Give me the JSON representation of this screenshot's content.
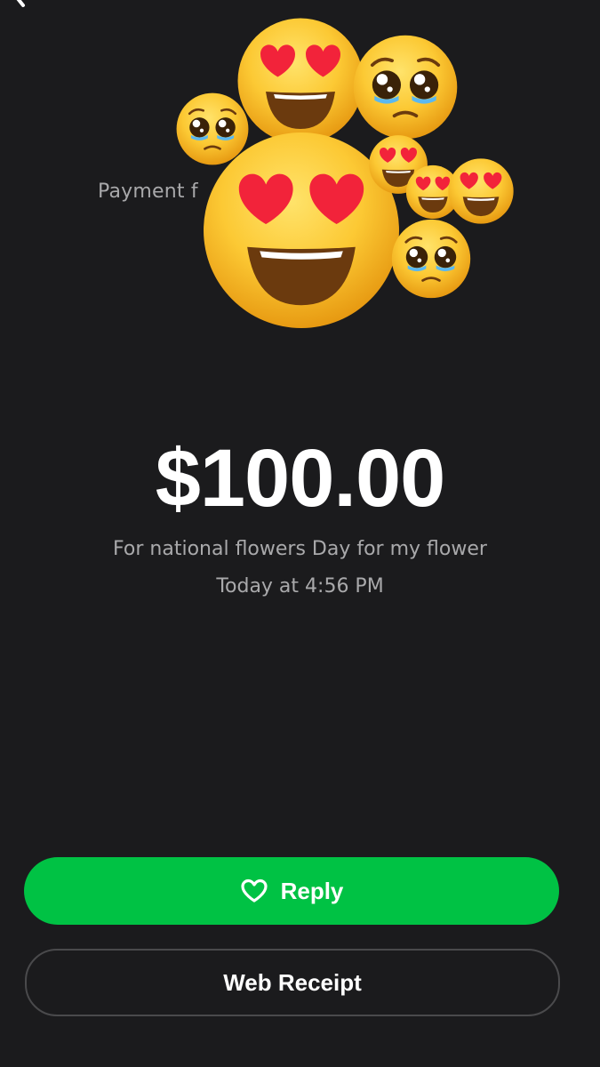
{
  "header": {
    "back_icon": "chevron-left-icon",
    "payment_from_label": "Payment f"
  },
  "payment": {
    "amount": "$100.00",
    "note": "For national flowers Day for my flower",
    "timestamp": "Today at 4:56 PM"
  },
  "stickers": {
    "types": [
      "heart-eyes-emoji",
      "pleading-face-emoji"
    ]
  },
  "actions": {
    "reply_label": "Reply",
    "reply_icon": "heart-outline-icon",
    "web_receipt_label": "Web Receipt"
  },
  "colors": {
    "background": "#1b1b1d",
    "accent_green": "#00c244",
    "text_primary": "#ffffff",
    "text_secondary": "#a9a9ab",
    "outline": "#4a4a4c"
  }
}
